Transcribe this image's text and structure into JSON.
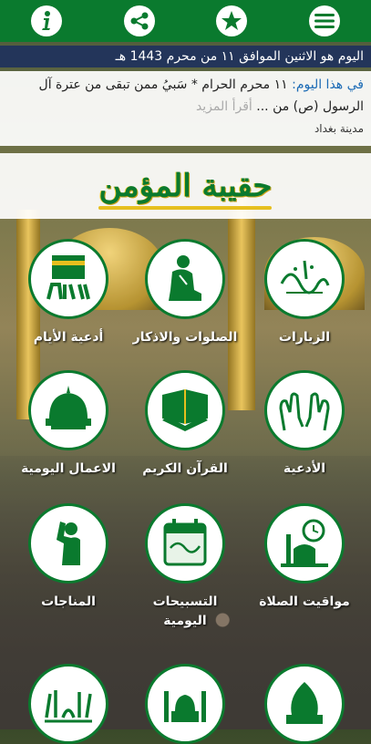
{
  "header": {
    "info_icon": "info-icon",
    "share_icon": "share-icon",
    "star_icon": "star-icon",
    "menu_icon": "menu-icon"
  },
  "date_line": "اليوم هو الاثنين الموافق ١١ من محرم 1443 هـ",
  "info": {
    "prefix": "في هذا اليوم:",
    "text": " ١١ محرم الحرام * سَبيُ ممن تبقى من عترة آل الرسول (ص) من ...",
    "more": " أقرأ المزيد",
    "city": "مدينة بغداد"
  },
  "title": "حقيبة المؤمن",
  "tiles": [
    {
      "label": "الزيارات",
      "icon": "ziyarat-icon"
    },
    {
      "label": "الصلوات والاذكار",
      "icon": "prayer-person-icon"
    },
    {
      "label": "أدعية الأيام",
      "icon": "kaaba-days-icon"
    },
    {
      "label": "الأدعية",
      "icon": "praying-hands-icon"
    },
    {
      "label": "القرآن الكريم",
      "icon": "quran-icon"
    },
    {
      "label": "الاعمال اليومية",
      "icon": "mosque-dome-icon"
    },
    {
      "label": "مواقيت الصلاة",
      "icon": "prayer-times-icon"
    },
    {
      "label": "التسبيحات اليومية",
      "icon": "calendar-tasbih-icon"
    },
    {
      "label": "المناجات",
      "icon": "supplicant-icon"
    },
    {
      "label": "",
      "icon": "mosque-dome-2-icon"
    },
    {
      "label": "",
      "icon": "mosque-icon"
    },
    {
      "label": "",
      "icon": "ahl-al-bayt-icon"
    }
  ]
}
